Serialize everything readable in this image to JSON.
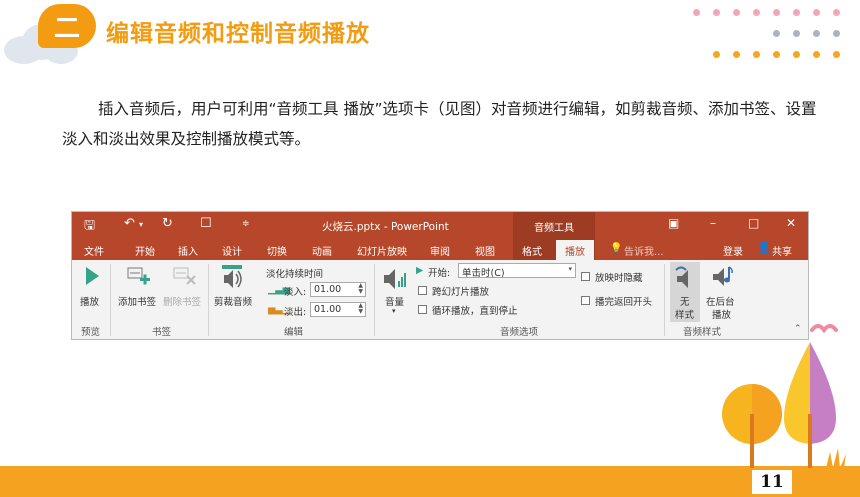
{
  "slide": {
    "badge": "二",
    "heading": "编辑音频和控制音频播放",
    "paragraph": "插入音频后，用户可利用“音频工具 播放”选项卡（见图）对音频进行编辑，如剪裁音频、添加书签、设置淡入和淡出效果及控制播放模式等。",
    "page_number": "11"
  },
  "window": {
    "title": "火烧云.pptx - PowerPoint",
    "context_group": "音频工具",
    "tabs": [
      "文件",
      "开始",
      "插入",
      "设计",
      "切换",
      "动画",
      "幻灯片放映",
      "审阅",
      "视图",
      "格式",
      "播放"
    ],
    "active_tab": "播放",
    "tell_me": "告诉我...",
    "sign_in": "登录",
    "share": "共享"
  },
  "ribbon": {
    "preview": {
      "play": "播放",
      "group": "预览"
    },
    "bookmarks": {
      "add": "添加书签",
      "remove": "删除书签",
      "group": "书签"
    },
    "editing": {
      "trim": "剪裁音频",
      "fade_duration": "淡化持续时间",
      "fade_in_label": "淡入:",
      "fade_in_value": "01.00",
      "fade_out_label": "淡出:",
      "fade_out_value": "01.00",
      "group": "编辑"
    },
    "audio_options": {
      "volume": "音量",
      "start_label": "开始:",
      "start_value": "单击时(C)",
      "play_across": "跨幻灯片播放",
      "loop": "循环播放，直到停止",
      "hide": "放映时隐藏",
      "rewind": "播完返回开头",
      "group": "音频选项"
    },
    "audio_styles": {
      "no_style_line1": "无",
      "no_style_line2": "样式",
      "background_line1": "在后台",
      "background_line2": "播放",
      "group": "音频样式"
    }
  },
  "colors": {
    "ppt_red": "#b7472a",
    "accent_orange": "#f39c12",
    "footer": "#f4a21f"
  }
}
